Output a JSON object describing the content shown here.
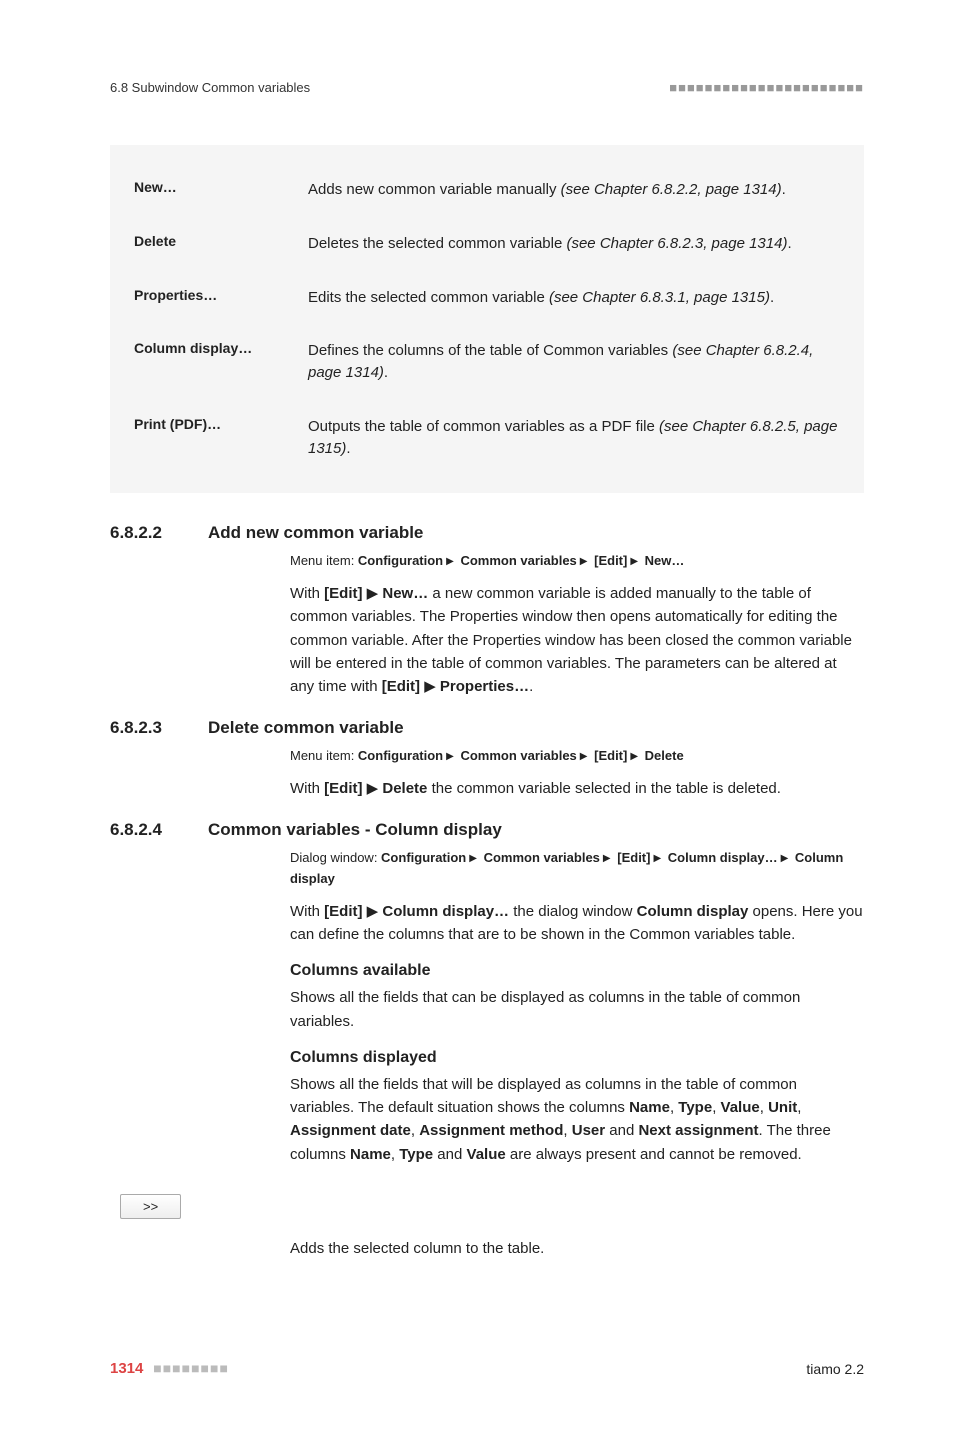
{
  "header": {
    "left": "6.8 Subwindow Common variables",
    "dots": "■■■■■■■■■■■■■■■■■■■■■■"
  },
  "defs": [
    {
      "label": "New…",
      "desc_pre": "Adds new common variable manually ",
      "desc_em": "(see Chapter 6.8.2.2, page 1314)",
      "desc_post": "."
    },
    {
      "label": "Delete",
      "desc_pre": "Deletes the selected common variable ",
      "desc_em": "(see Chapter 6.8.2.3, page 1314)",
      "desc_post": "."
    },
    {
      "label": "Properties…",
      "desc_pre": "Edits the selected common variable ",
      "desc_em": "(see Chapter 6.8.3.1, page 1315)",
      "desc_post": "."
    },
    {
      "label": "Column display…",
      "desc_pre": "Defines the columns of the table of Common variables ",
      "desc_em": "(see Chapter 6.8.2.4, page 1314)",
      "desc_post": "."
    },
    {
      "label": "Print (PDF)…",
      "desc_pre": "Outputs the table of common variables as a PDF file ",
      "desc_em": "(see Chapter 6.8.2.5, page 1315)",
      "desc_post": "."
    }
  ],
  "s1": {
    "num": "6.8.2.2",
    "title": "Add new common variable",
    "menu_prefix": "Menu item: ",
    "menu_parts": [
      "Configuration",
      "Common variables",
      "[Edit]",
      "New…"
    ],
    "body_parts": {
      "p1a": "With ",
      "p1b": "[Edit]",
      "p1c": "New…",
      "p1d": " a new common variable is added manually to the table of common variables. The Properties window then opens automatically for editing the common variable. After the Properties window has been closed the common variable will be entered in the table of common variables. The parameters can be altered at any time with ",
      "p1e": "[Edit]",
      "p1f": "Properties…",
      "p1g": "."
    }
  },
  "s2": {
    "num": "6.8.2.3",
    "title": "Delete common variable",
    "menu_prefix": "Menu item: ",
    "menu_parts": [
      "Configuration",
      "Common variables",
      "[Edit]",
      "Delete"
    ],
    "body_parts": {
      "a": "With ",
      "b": "[Edit]",
      "c": "Delete",
      "d": " the common variable selected in the table is deleted."
    }
  },
  "s3": {
    "num": "6.8.2.4",
    "title": "Common variables - Column display",
    "menu_prefix": "Dialog window: ",
    "menu_parts_line1": [
      "Configuration",
      "Common variables",
      "[Edit]",
      "Column display…"
    ],
    "menu_parts_line2": [
      "Column display"
    ],
    "body1": {
      "a": "With ",
      "b": "[Edit]",
      "c": "Column display…",
      "d": " the dialog window ",
      "e": "Column display",
      "f": " opens. Here you can define the columns that are to be shown in the Common variables table."
    },
    "cols_avail_head": "Columns available",
    "cols_avail_body": "Shows all the fields that can be displayed as columns in the table of common variables.",
    "cols_disp_head": "Columns displayed",
    "cols_disp": {
      "a": "Shows all the fields that will be displayed as columns in the table of common variables. The default situation shows the columns ",
      "b": "Name",
      "c": ", ",
      "d": "Type",
      "e": ", ",
      "f": "Value",
      "g": ", ",
      "h": "Unit",
      "i": ", ",
      "j": "Assignment date",
      "k": ", ",
      "l": "Assignment method",
      "m": ", ",
      "n": "User",
      "o": " and ",
      "p": "Next assignment",
      "q": ". The three columns ",
      "r": "Name",
      "s": ", ",
      "t": "Type",
      "u": " and ",
      "v": "Value",
      "w": " are always present and cannot be removed."
    },
    "btn_label": ">>",
    "btn_caption": "Adds the selected column to the table."
  },
  "footer": {
    "page": "1314",
    "dots": "■■■■■■■■",
    "right": "tiamo 2.2"
  }
}
